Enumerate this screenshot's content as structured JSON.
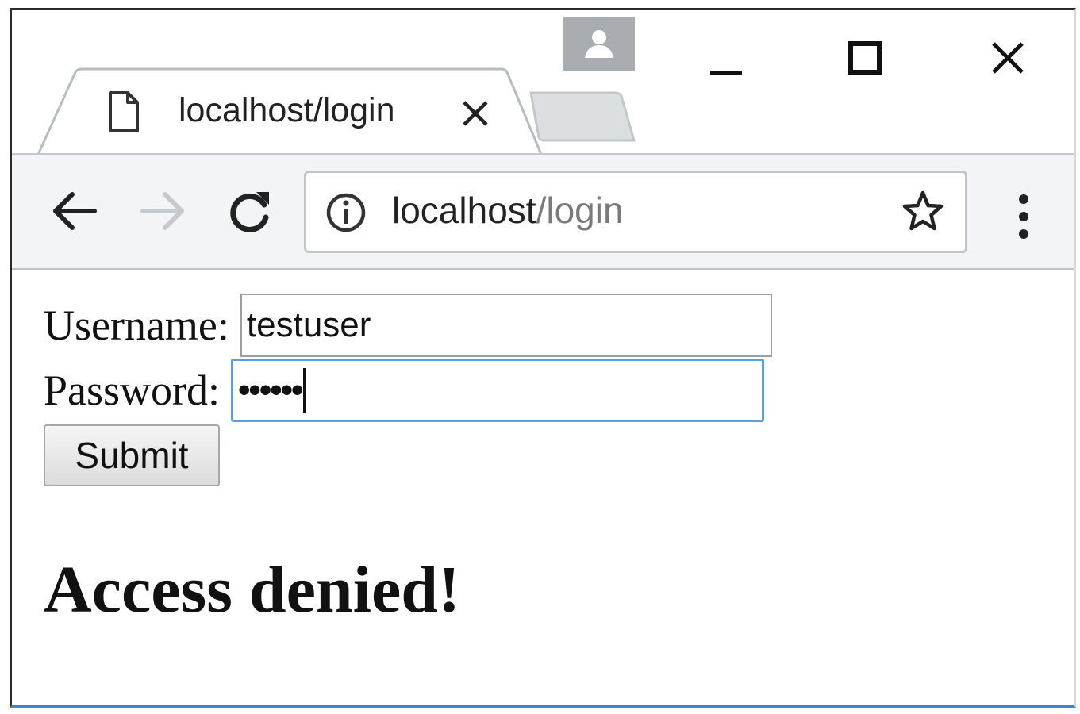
{
  "tab": {
    "title": "localhost/login"
  },
  "address_bar": {
    "host": "localhost",
    "path": "/login"
  },
  "form": {
    "username_label": "Username:",
    "username_value": "testuser",
    "password_label": "Password:",
    "password_value": "••••••",
    "submit_label": "Submit"
  },
  "result": {
    "message": "Access denied!"
  },
  "icons": {
    "tab": "page-icon",
    "tab_close": "close-icon",
    "profile": "profile-icon",
    "minimize": "minimize-icon",
    "maximize": "maximize-icon",
    "close": "close-icon",
    "back": "back-arrow-icon",
    "forward": "forward-arrow-icon",
    "reload": "reload-icon",
    "info": "info-icon",
    "bookmark": "star-icon",
    "menu": "more-vert-icon"
  },
  "colors": {
    "focus_ring": "#5b9de1",
    "window_accent": "#3f86c8",
    "toolbar_bg": "#f3f4f5"
  }
}
